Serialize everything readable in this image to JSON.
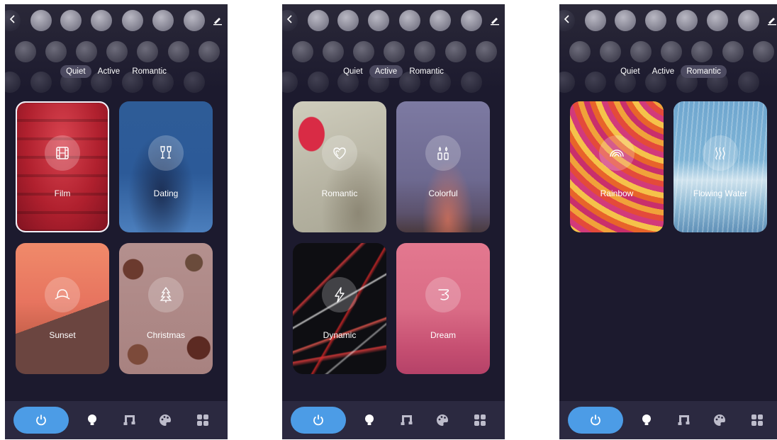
{
  "screens": [
    {
      "tabs": [
        "Quiet",
        "Active",
        "Romantic"
      ],
      "active_tab": "Quiet",
      "cards": [
        {
          "label": "Film",
          "icon": "film-icon",
          "selected": true
        },
        {
          "label": "Dating",
          "icon": "wine-glasses-icon",
          "selected": false
        },
        {
          "label": "Sunset",
          "icon": "sunset-icon",
          "selected": false
        },
        {
          "label": "Christmas",
          "icon": "christmas-tree-icon",
          "selected": false
        }
      ]
    },
    {
      "tabs": [
        "Quiet",
        "Active",
        "Romantic"
      ],
      "active_tab": "Active",
      "cards": [
        {
          "label": "Romantic",
          "icon": "hearts-icon"
        },
        {
          "label": "Colorful",
          "icon": "candles-icon"
        },
        {
          "label": "Dynamic",
          "icon": "lightning-icon"
        },
        {
          "label": "Dream",
          "icon": "dream-icon"
        }
      ]
    },
    {
      "tabs": [
        "Quiet",
        "Active",
        "Romantic"
      ],
      "active_tab": "Romantic",
      "cards": [
        {
          "label": "Rainbow",
          "icon": "rainbow-icon"
        },
        {
          "label": "Flowing Water",
          "icon": "waves-icon"
        }
      ]
    }
  ],
  "nav": {
    "items": [
      "power-icon",
      "bulb-icon",
      "music-icon",
      "palette-icon",
      "scenes-icon"
    ],
    "active": "power-icon"
  },
  "colors": {
    "background": "#1c1a2e",
    "navbar": "#2b2940",
    "accent": "#4c9ce6",
    "active_tab": "#4c4a60"
  }
}
